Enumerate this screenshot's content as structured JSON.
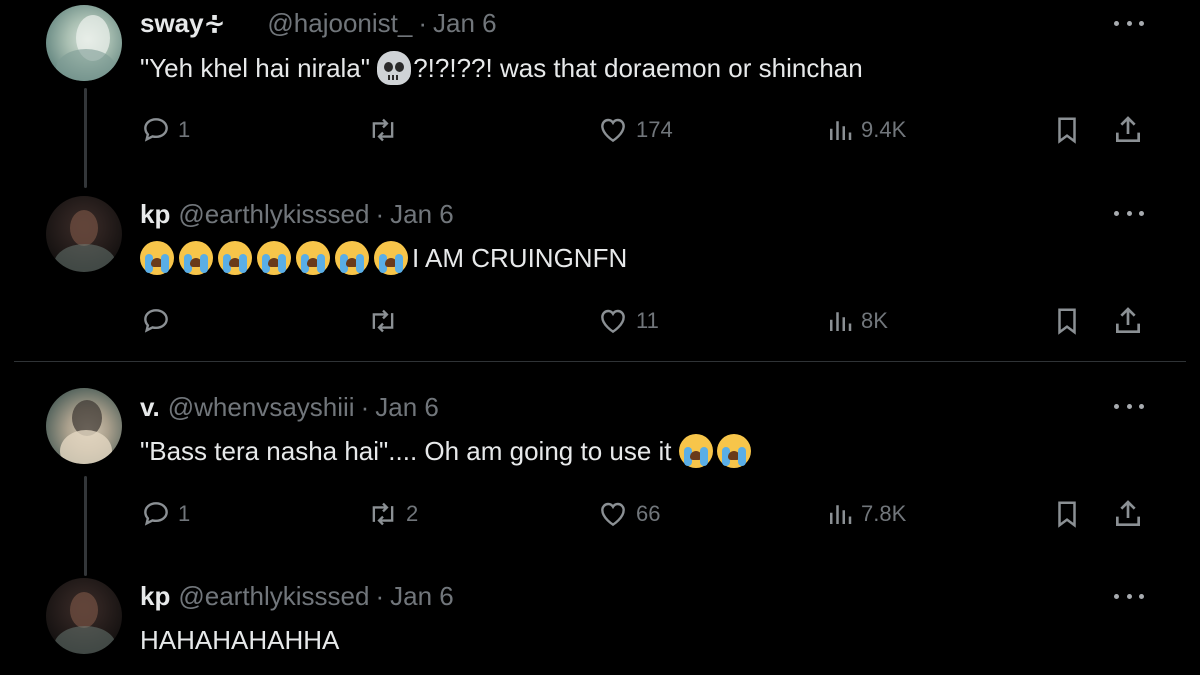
{
  "tweets": [
    {
      "name": "sway∻",
      "handle": "@hajoonist_",
      "date": "Jan 6",
      "text_before": "\"Yeh khel hai nirala\" ",
      "text_after": "?!?!??! was that doraemon or shinchan",
      "emoji": "skull",
      "replies": "1",
      "retweets": "",
      "likes": "174",
      "views": "9.4K"
    },
    {
      "name": "kp",
      "handle": "@earthlykisssed",
      "date": "Jan 6",
      "text_after": "I AM CRUINGNFN",
      "emoji": "loudly-crying-face",
      "emoji_count": 7,
      "replies": "",
      "retweets": "",
      "likes": "11",
      "views": "8K"
    },
    {
      "name": "v.",
      "handle": "@whenvsayshiii",
      "date": "Jan 6",
      "text_before": "\"Bass tera nasha hai\".... Oh am going to use it ",
      "emoji": "loudly-crying-face",
      "emoji_count": 2,
      "replies": "1",
      "retweets": "2",
      "likes": "66",
      "views": "7.8K"
    },
    {
      "name": "kp",
      "handle": "@earthlykisssed",
      "date": "Jan 6",
      "text_after": "HAHAHAHAHHA"
    }
  ],
  "separator": "·",
  "icons": [
    "more-icon",
    "reply-icon",
    "retweet-icon",
    "like-icon",
    "views-icon",
    "bookmark-icon",
    "share-icon"
  ],
  "colors": {
    "background": "#000000",
    "text": "#e7e9ea",
    "muted": "#71767b",
    "divider": "#2f3336"
  }
}
